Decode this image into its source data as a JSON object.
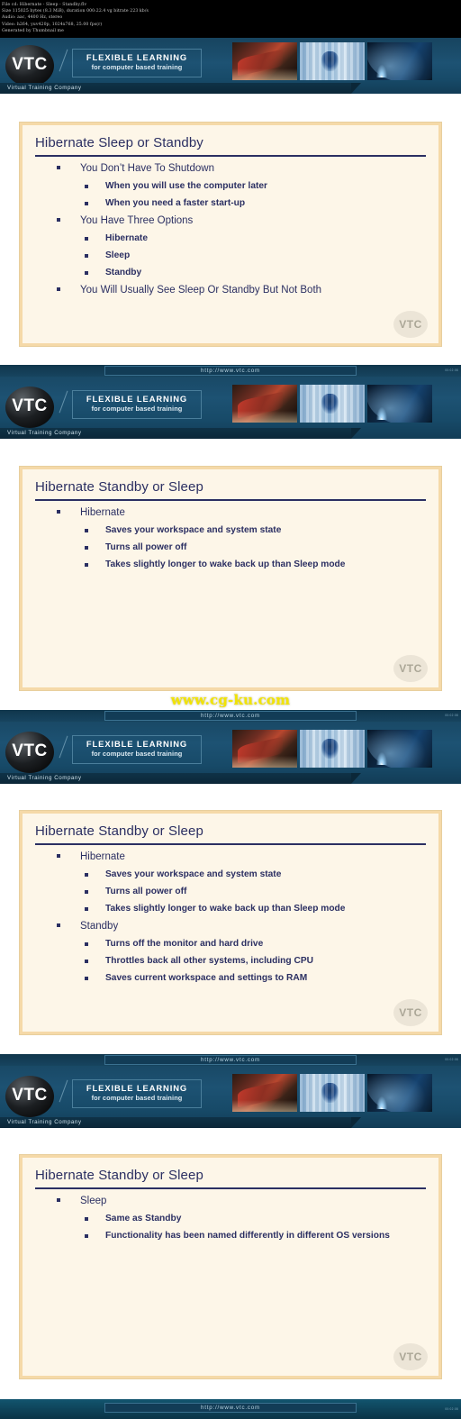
{
  "metadata": {
    "lines": [
      "File cd: Hibernate - Sleep - Standby.flv",
      "Size 115025 bytes (8.3 MiB), duration 000:22.4 vg bitrate 223 kb/s",
      "Audio: aac, 4400 Hz, stereo",
      "Video: h264, yuv420p, 1024x768, 25.00 fps(r)",
      "Generated by Thumbnail me"
    ]
  },
  "banner": {
    "logo_text": "VTC",
    "tagline_main": "FLEXIBLE LEARNING",
    "tagline_sub": "for computer based training",
    "company": "Virtual Training Company",
    "url": "http://www.vtc.com",
    "url_code": "00:02:08",
    "photos": [
      "hands-on-keyboard-photo",
      "office-building-person-photo",
      "light-beam-curve-photo"
    ]
  },
  "watermark": {
    "slide_corner": "VTC",
    "overlay_site": "www.cg-ku.com"
  },
  "colors": {
    "banner_blue": "#1d5273",
    "slide_bg": "#fdf6e8",
    "slide_border": "#f5d9a8",
    "text_navy": "#2b2f62",
    "watermark_yellow": "#f2e400"
  },
  "slides": [
    {
      "title": "Hibernate Sleep or Standby",
      "bullets": [
        {
          "level": 1,
          "text": "You Don’t Have To Shutdown"
        },
        {
          "level": 2,
          "text": "When you will use the computer later"
        },
        {
          "level": 2,
          "text": "When you need a faster start-up"
        },
        {
          "level": 1,
          "text": "You Have Three Options"
        },
        {
          "level": 2,
          "text": "Hibernate"
        },
        {
          "level": 2,
          "text": "Sleep"
        },
        {
          "level": 2,
          "text": "Standby"
        },
        {
          "level": 1,
          "text": "You Will Usually See Sleep Or Standby But Not Both"
        }
      ]
    },
    {
      "title": "Hibernate Standby or Sleep",
      "bullets": [
        {
          "level": 1,
          "text": "Hibernate"
        },
        {
          "level": 2,
          "text": "Saves your workspace and system state"
        },
        {
          "level": 2,
          "text": "Turns all power off"
        },
        {
          "level": 2,
          "text": "Takes slightly longer to wake back up than Sleep mode"
        }
      ]
    },
    {
      "title": "Hibernate Standby or Sleep",
      "bullets": [
        {
          "level": 1,
          "text": "Hibernate"
        },
        {
          "level": 2,
          "text": "Saves your workspace and system state"
        },
        {
          "level": 2,
          "text": "Turns all power off"
        },
        {
          "level": 2,
          "text": "Takes slightly longer to wake back up than Sleep mode"
        },
        {
          "level": 1,
          "text": "Standby"
        },
        {
          "level": 2,
          "text": "Turns off the monitor and hard drive"
        },
        {
          "level": 2,
          "text": "Throttles back all other systems, including CPU"
        },
        {
          "level": 2,
          "text": "Saves current workspace and settings to RAM"
        }
      ]
    },
    {
      "title": "Hibernate Standby or Sleep",
      "bullets": [
        {
          "level": 1,
          "text": "Sleep"
        },
        {
          "level": 2,
          "text": "Same as Standby"
        },
        {
          "level": 2,
          "text": "Functionality has been named differently in different OS versions"
        }
      ]
    }
  ]
}
